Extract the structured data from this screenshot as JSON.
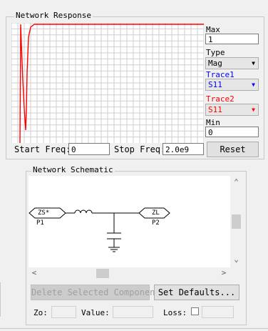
{
  "response": {
    "title": "Network Response",
    "max_label": "Max",
    "max_value": "1",
    "type_label": "Type",
    "type_value": "Mag",
    "trace1_label": "Trace1",
    "trace1_value": "S11",
    "trace2_label": "Trace2",
    "trace2_value": "S11",
    "min_label": "Min",
    "min_value": "0",
    "start_label": "Start Freq:",
    "start_value": "0",
    "stop_label": "Stop Freq:",
    "stop_value": "2.0e9",
    "reset_label": "Reset",
    "colors": {
      "trace1": "#0000ff",
      "trace2": "#ff0000"
    }
  },
  "schematic": {
    "title": "Network Schematic",
    "source_label": "ZS*",
    "port1_label": "P1",
    "load_label": "ZL",
    "port2_label": "P2"
  },
  "actions": {
    "delete_label": "Delete Selected Component",
    "defaults_label": "Set Defaults..."
  },
  "fields": {
    "zo_label": "Zo:",
    "zo_value": "",
    "value_label": "Value:",
    "value_value": "",
    "loss_label": "Loss:",
    "loss_value": ""
  }
}
